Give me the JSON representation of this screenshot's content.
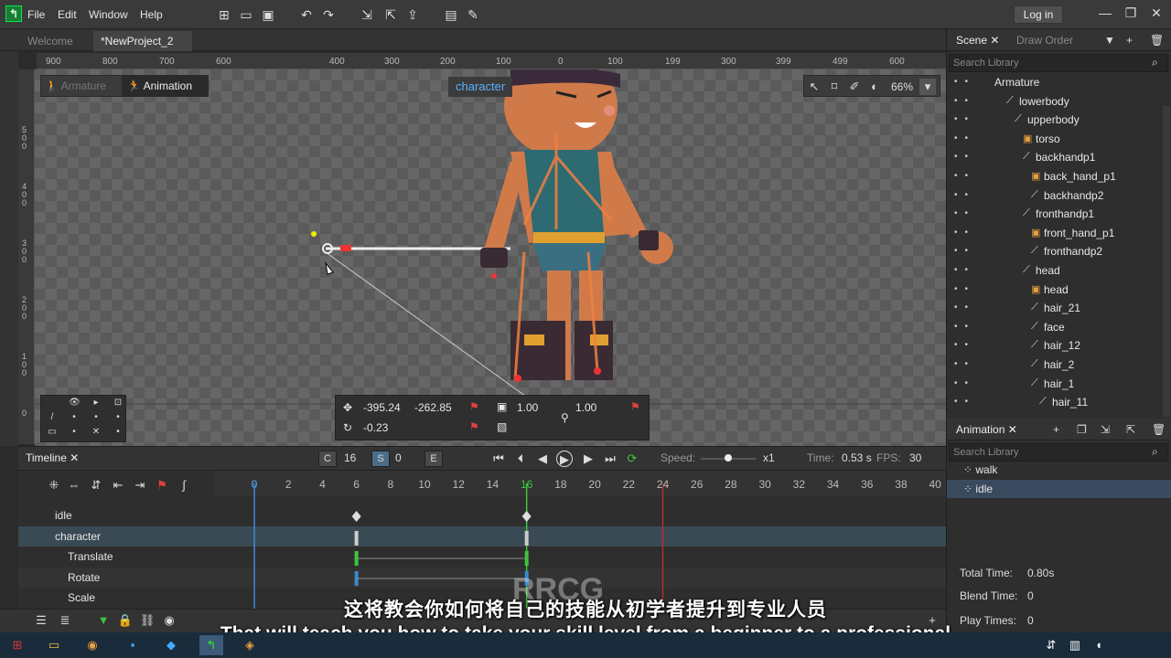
{
  "menu": [
    "File",
    "Edit",
    "Window",
    "Help"
  ],
  "login_label": "Log in",
  "doc_tabs": [
    {
      "label": "Welcome"
    },
    {
      "label": "*NewProject_2"
    }
  ],
  "ruler_top": [
    "900",
    "800",
    "700",
    "600",
    "400",
    "300",
    "200",
    "100",
    "0",
    "100",
    "199",
    "300",
    "399",
    "499",
    "600"
  ],
  "ruler_left": [
    "500",
    "400",
    "300",
    "200",
    "100",
    "0"
  ],
  "mode": {
    "armature": "Armature",
    "animation": "Animation"
  },
  "zoom": "66%",
  "bone_label": "character",
  "transform": {
    "x": "-395.24",
    "y": "-262.85",
    "rotation": "-0.23",
    "scale_x": "1.00",
    "scale_y": "1.00"
  },
  "scene_panel": {
    "tabs": [
      "Scene",
      "Draw Order"
    ],
    "search_placeholder": "Search Library",
    "tree": [
      {
        "label": "Armature",
        "depth": 0,
        "icon": "none"
      },
      {
        "label": "lowerbody",
        "depth": 1,
        "icon": "bone"
      },
      {
        "label": "upperbody",
        "depth": 2,
        "icon": "bone"
      },
      {
        "label": "torso",
        "depth": 3,
        "icon": "image"
      },
      {
        "label": "backhandp1",
        "depth": 3,
        "icon": "bone"
      },
      {
        "label": "back_hand_p1",
        "depth": 4,
        "icon": "image"
      },
      {
        "label": "backhandp2",
        "depth": 4,
        "icon": "bone"
      },
      {
        "label": "fronthandp1",
        "depth": 3,
        "icon": "bone"
      },
      {
        "label": "front_hand_p1",
        "depth": 4,
        "icon": "image"
      },
      {
        "label": "fronthandp2",
        "depth": 4,
        "icon": "bone"
      },
      {
        "label": "head",
        "depth": 3,
        "icon": "bone"
      },
      {
        "label": "head",
        "depth": 4,
        "icon": "image"
      },
      {
        "label": "hair_21",
        "depth": 4,
        "icon": "bone"
      },
      {
        "label": "face",
        "depth": 4,
        "icon": "bone"
      },
      {
        "label": "hair_12",
        "depth": 4,
        "icon": "bone"
      },
      {
        "label": "hair_2",
        "depth": 4,
        "icon": "bone"
      },
      {
        "label": "hair_1",
        "depth": 4,
        "icon": "bone"
      },
      {
        "label": "hair_11",
        "depth": 5,
        "icon": "bone"
      }
    ]
  },
  "anim_panel": {
    "tab": "Animation",
    "search_placeholder": "Search Library",
    "items": [
      "walk",
      "idle"
    ],
    "total_time_label": "Total Time:",
    "total_time": "0.80s",
    "blend_time_label": "Blend Time:",
    "blend_time": "0",
    "play_times_label": "Play Times:",
    "play_times": "0"
  },
  "timeline": {
    "tab": "Timeline",
    "current_frame_label": "C",
    "current_frame": "16",
    "start_label": "S",
    "start": "0",
    "end_label": "E",
    "speed_label": "Speed:",
    "speed": "x1",
    "time_label": "Time:",
    "time": "0.53 s",
    "fps_label": "FPS:",
    "fps": "30",
    "frames": [
      "0",
      "2",
      "4",
      "6",
      "8",
      "10",
      "12",
      "14",
      "16",
      "18",
      "20",
      "22",
      "24",
      "26",
      "28",
      "30",
      "32",
      "34",
      "36",
      "38",
      "40"
    ],
    "tracks": [
      {
        "name": "idle"
      },
      {
        "name": "character"
      },
      {
        "name": "Translate"
      },
      {
        "name": "Rotate"
      },
      {
        "name": "Scale"
      }
    ]
  },
  "subtitle_cn": "这将教会你如何将自己的技能从初学者提升到专业人员",
  "subtitle_en": "That will teach you how to take your skill level from a beginner to a professional",
  "watermark": "RRCG",
  "colors": {
    "accent": "#5ab0ff",
    "flag": "#e04040",
    "playhead": "#3ec43e"
  }
}
